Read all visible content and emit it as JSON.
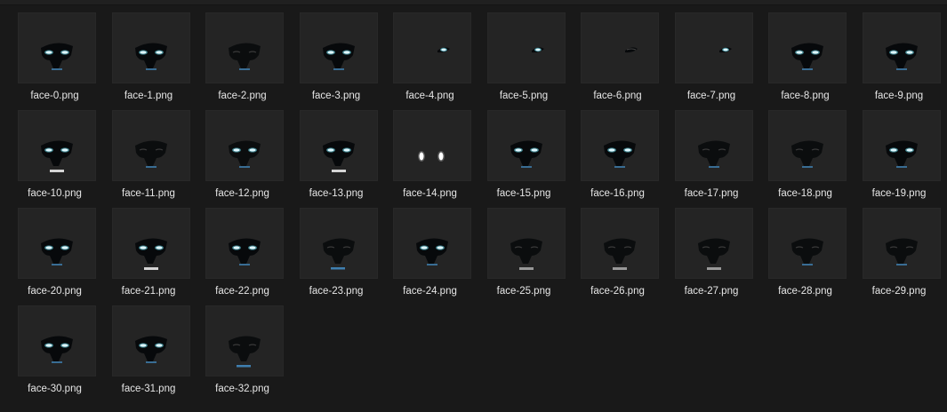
{
  "window": {
    "background": "#191919",
    "tile_background": "#242424"
  },
  "colors": {
    "eye_glow": "#dff7ff",
    "eye_halo": "#5fd3e6",
    "mask": "#07090b",
    "mouth": "#3f7fb0",
    "teeth": "#e8e8e8"
  },
  "files": [
    {
      "name": "face-0.png",
      "icon": "face-thumbnail"
    },
    {
      "name": "face-1.png",
      "icon": "face-thumbnail"
    },
    {
      "name": "face-2.png",
      "icon": "face-thumbnail"
    },
    {
      "name": "face-3.png",
      "icon": "face-thumbnail"
    },
    {
      "name": "face-4.png",
      "icon": "face-thumbnail"
    },
    {
      "name": "face-5.png",
      "icon": "face-thumbnail"
    },
    {
      "name": "face-6.png",
      "icon": "face-thumbnail"
    },
    {
      "name": "face-7.png",
      "icon": "face-thumbnail"
    },
    {
      "name": "face-8.png",
      "icon": "face-thumbnail"
    },
    {
      "name": "face-9.png",
      "icon": "face-thumbnail"
    },
    {
      "name": "face-10.png",
      "icon": "face-thumbnail"
    },
    {
      "name": "face-11.png",
      "icon": "face-thumbnail"
    },
    {
      "name": "face-12.png",
      "icon": "face-thumbnail"
    },
    {
      "name": "face-13.png",
      "icon": "face-thumbnail"
    },
    {
      "name": "face-14.png",
      "icon": "face-thumbnail"
    },
    {
      "name": "face-15.png",
      "icon": "face-thumbnail"
    },
    {
      "name": "face-16.png",
      "icon": "face-thumbnail"
    },
    {
      "name": "face-17.png",
      "icon": "face-thumbnail"
    },
    {
      "name": "face-18.png",
      "icon": "face-thumbnail"
    },
    {
      "name": "face-19.png",
      "icon": "face-thumbnail"
    },
    {
      "name": "face-20.png",
      "icon": "face-thumbnail"
    },
    {
      "name": "face-21.png",
      "icon": "face-thumbnail"
    },
    {
      "name": "face-22.png",
      "icon": "face-thumbnail"
    },
    {
      "name": "face-23.png",
      "icon": "face-thumbnail"
    },
    {
      "name": "face-24.png",
      "icon": "face-thumbnail"
    },
    {
      "name": "face-25.png",
      "icon": "face-thumbnail"
    },
    {
      "name": "face-26.png",
      "icon": "face-thumbnail"
    },
    {
      "name": "face-27.png",
      "icon": "face-thumbnail"
    },
    {
      "name": "face-28.png",
      "icon": "face-thumbnail"
    },
    {
      "name": "face-29.png",
      "icon": "face-thumbnail"
    },
    {
      "name": "face-30.png",
      "icon": "face-thumbnail"
    },
    {
      "name": "face-31.png",
      "icon": "face-thumbnail"
    },
    {
      "name": "face-32.png",
      "icon": "face-thumbnail"
    }
  ]
}
